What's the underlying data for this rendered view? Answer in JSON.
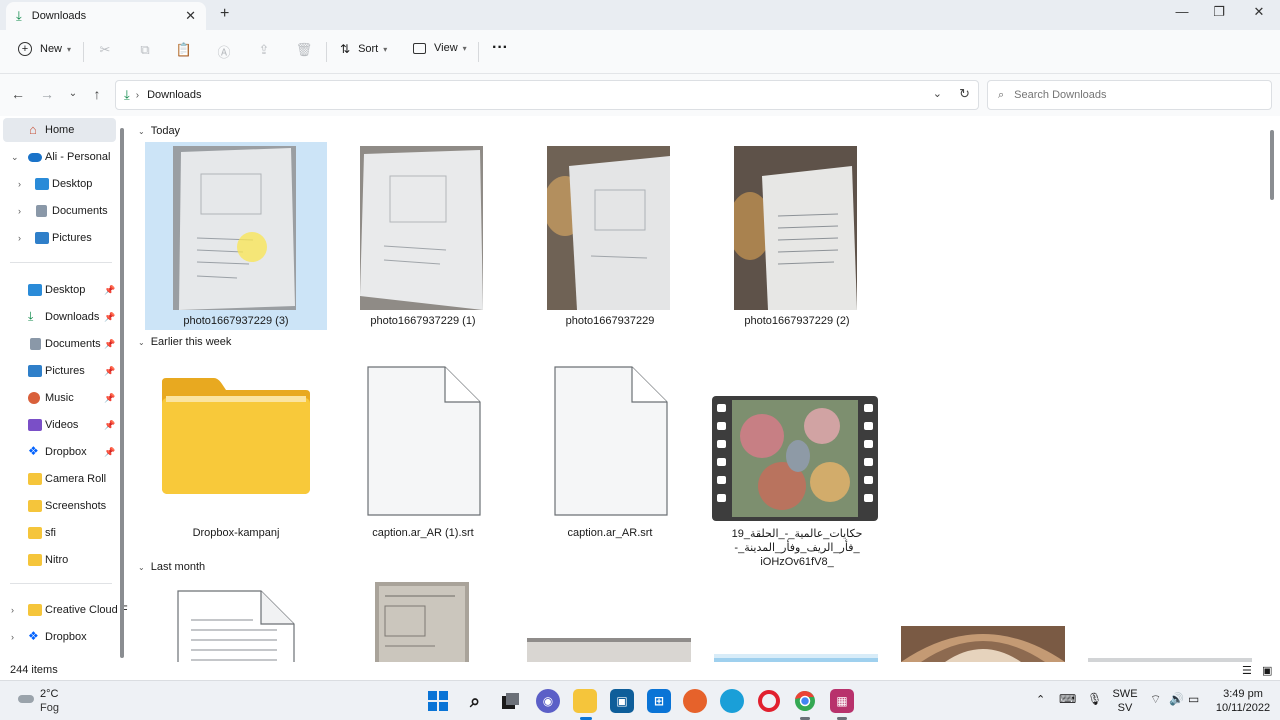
{
  "window": {
    "tab_title": "Downloads",
    "tab_close": "✕",
    "new_tab": "+",
    "minimize": "—",
    "maximize": "❐",
    "close": "✕"
  },
  "toolbar": {
    "new_label": "New",
    "sort_label": "Sort",
    "view_label": "View",
    "more_label": "···"
  },
  "address": {
    "breadcrumb": "Downloads",
    "search_placeholder": "Search Downloads"
  },
  "sidebar": {
    "items": [
      {
        "label": "Home"
      },
      {
        "label": "Ali - Personal"
      },
      {
        "label": "Desktop"
      },
      {
        "label": "Documents"
      },
      {
        "label": "Pictures"
      },
      {
        "label": "Desktop"
      },
      {
        "label": "Downloads"
      },
      {
        "label": "Documents"
      },
      {
        "label": "Pictures"
      },
      {
        "label": "Music"
      },
      {
        "label": "Videos"
      },
      {
        "label": "Dropbox"
      },
      {
        "label": "Camera Roll"
      },
      {
        "label": "Screenshots"
      },
      {
        "label": "sfi"
      },
      {
        "label": "Nitro"
      },
      {
        "label": "Creative Cloud F"
      },
      {
        "label": "Dropbox"
      }
    ]
  },
  "groups": {
    "today": "Today",
    "earlier": "Earlier this week",
    "last_month": "Last month"
  },
  "files": {
    "today": [
      {
        "name": "photo1667937229 (3)"
      },
      {
        "name": "photo1667937229 (1)"
      },
      {
        "name": "photo1667937229"
      },
      {
        "name": "photo1667937229 (2)"
      }
    ],
    "earlier": [
      {
        "name": "Dropbox-kampanj"
      },
      {
        "name": "caption.ar_AR (1).srt"
      },
      {
        "name": "caption.ar_AR.srt"
      },
      {
        "name_line1": "حكايات_عالمية_-_الحلقة_19",
        "name_line2": "_فأر_الريف_وفأر_المدينة_-_iOHzOv61fV8"
      }
    ]
  },
  "status": {
    "item_count": "244 items"
  },
  "taskbar": {
    "temp": "2°C",
    "condition": "Fog",
    "lang1": "SWE",
    "lang2": "SV",
    "time": "3:49 pm",
    "date": "10/11/2022"
  },
  "colors": {
    "selection": "#cce4f7",
    "folder": "#f8c93a",
    "accent": "#0067c0"
  }
}
